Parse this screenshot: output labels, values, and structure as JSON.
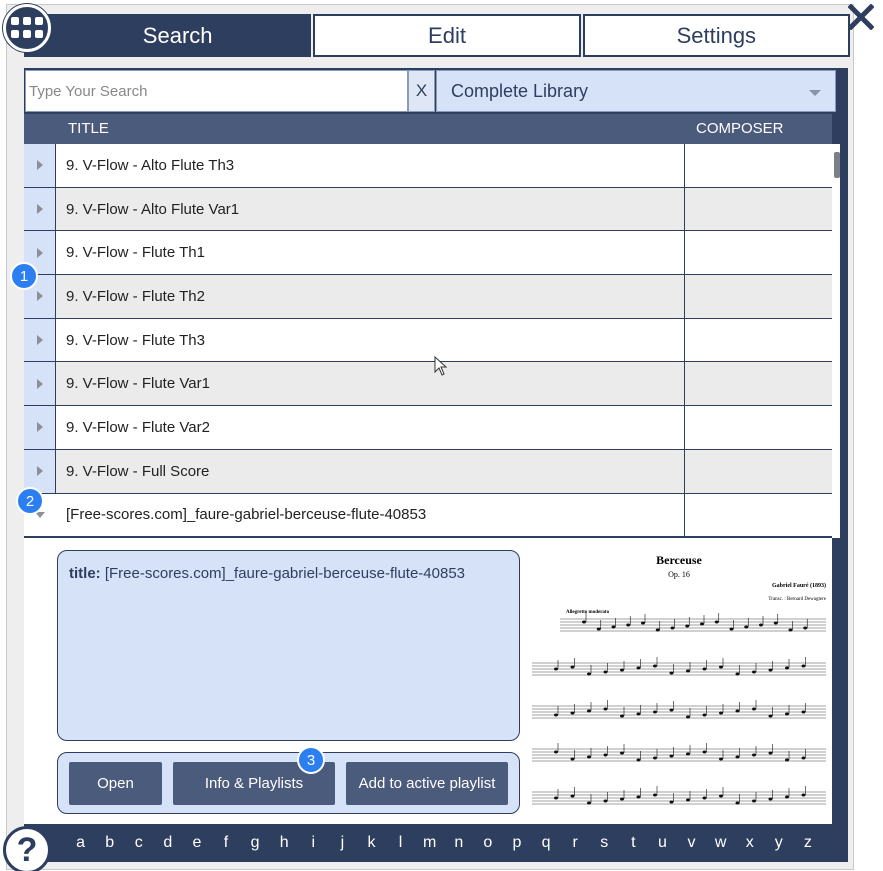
{
  "tabs": [
    {
      "label": "Search",
      "active": true
    },
    {
      "label": "Edit",
      "active": false
    },
    {
      "label": "Settings",
      "active": false
    }
  ],
  "search": {
    "placeholder": "Type Your Search",
    "value": "",
    "clear_label": "X",
    "library": "Complete Library"
  },
  "table": {
    "columns": [
      "TITLE",
      "COMPOSER"
    ],
    "rows": [
      {
        "title": "9. V-Flow - Alto Flute Th3",
        "composer": ""
      },
      {
        "title": "9. V-Flow - Alto Flute Var1",
        "composer": ""
      },
      {
        "title": "9. V-Flow - Flute Th1",
        "composer": ""
      },
      {
        "title": "9. V-Flow - Flute Th2",
        "composer": ""
      },
      {
        "title": "9. V-Flow - Flute Th3",
        "composer": ""
      },
      {
        "title": "9. V-Flow - Flute Var1",
        "composer": ""
      },
      {
        "title": "9. V-Flow - Flute Var2",
        "composer": ""
      },
      {
        "title": "9. V-Flow - Full Score",
        "composer": ""
      },
      {
        "title": "[Free-scores.com]_faure-gabriel-berceuse-flute-40853",
        "composer": ""
      }
    ]
  },
  "detail": {
    "title_key": "title:",
    "title_value": "[Free-scores.com]_faure-gabriel-berceuse-flute-40853",
    "buttons": {
      "open": "Open",
      "info": "Info & Playlists",
      "add": "Add to active playlist"
    },
    "score": {
      "heading": "Berceuse",
      "opus": "Op. 16",
      "composer": "Gabriel Fauré (1893)",
      "transcriber": "Transc. : Bernard Dewagtere",
      "tempo": "Allegretto moderato"
    }
  },
  "alphabet": [
    "a",
    "b",
    "c",
    "d",
    "e",
    "f",
    "g",
    "h",
    "i",
    "j",
    "k",
    "l",
    "m",
    "n",
    "o",
    "p",
    "q",
    "r",
    "s",
    "t",
    "u",
    "v",
    "w",
    "x",
    "y",
    "z"
  ],
  "badges": [
    "1",
    "2",
    "3"
  ],
  "help_label": "?",
  "colors": {
    "navy": "#2e3e5e",
    "header": "#4a5b7c",
    "light_blue": "#d6e2f8",
    "badge_blue": "#2b7ff0"
  }
}
